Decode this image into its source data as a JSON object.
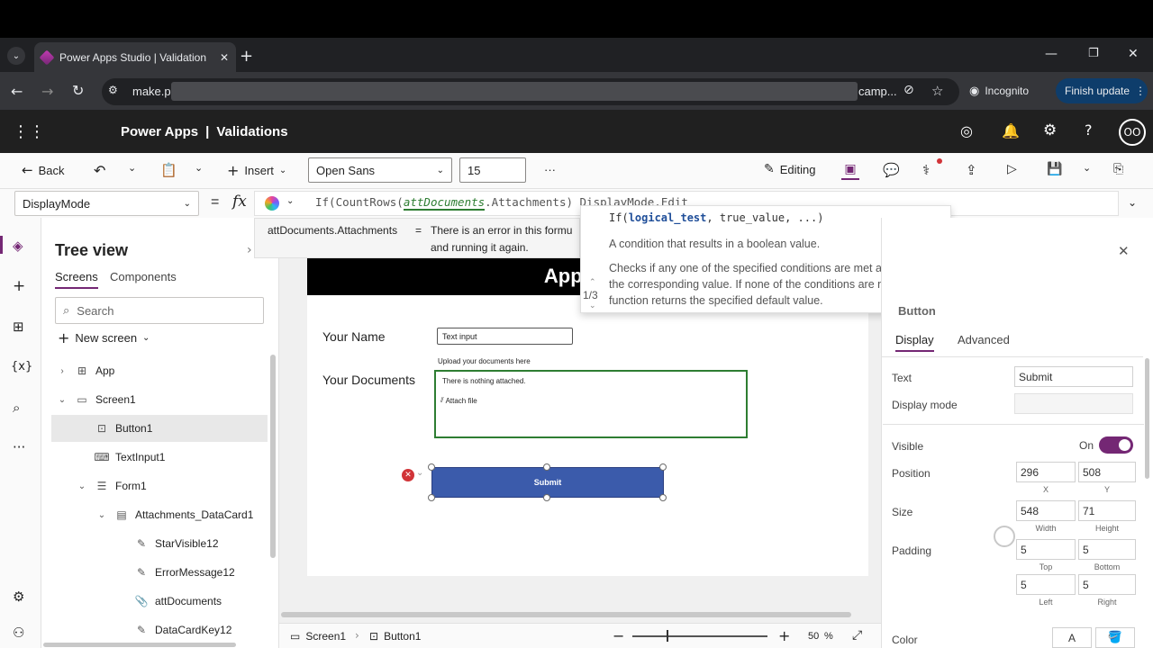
{
  "browser": {
    "tab_title": "Power Apps Studio | Validation",
    "new_tab": "+",
    "url_start": "make.p",
    "url_end": "camp...",
    "incognito": "Incognito",
    "finish_update": "Finish update"
  },
  "app_header": {
    "product": "Power Apps",
    "separator": "|",
    "app_name": "Validations",
    "avatar": "OO"
  },
  "command_bar": {
    "back": "Back",
    "insert": "Insert",
    "font": "Open Sans",
    "font_size": "15",
    "more": "···",
    "editing": "Editing"
  },
  "formula_bar": {
    "property": "DisplayMode",
    "equals": "=",
    "fx": "fx",
    "formula_part1": "If(CountRows(",
    "formula_arg": "attDocuments",
    "formula_part2": ".Attachments)",
    "formula_part3": " DisplayMode.Edit"
  },
  "error_popup": {
    "term": "attDocuments.Attachments",
    "equals": "=",
    "line1": "There is an error in this formu",
    "line2": "and running it again."
  },
  "intellisense": {
    "signature_prefix": "If(",
    "signature_param": "logical_test",
    "signature_rest": ", true_value, ...)",
    "counter": "1/3",
    "desc1": "A condition that results in a boolean value.",
    "desc2": "Checks if any one of the specified conditions are met and returns the corresponding value. If none of the conditions are met, the function returns the specified default value."
  },
  "tree": {
    "title": "Tree view",
    "tabs": [
      "Screens",
      "Components"
    ],
    "search_placeholder": "Search",
    "new_screen": "New screen",
    "items": [
      {
        "label": "App",
        "chev": "›",
        "icon": "⊞"
      },
      {
        "label": "Screen1",
        "chev": "⌄",
        "icon": "▭"
      },
      {
        "label": "Button1",
        "chev": "",
        "icon": "⊡"
      },
      {
        "label": "TextInput1",
        "chev": "",
        "icon": "⌨"
      },
      {
        "label": "Form1",
        "chev": "⌄",
        "icon": "☰"
      },
      {
        "label": "Attachments_DataCard1",
        "chev": "⌄",
        "icon": "▤"
      },
      {
        "label": "StarVisible12",
        "chev": "",
        "icon": "✎"
      },
      {
        "label": "ErrorMessage12",
        "chev": "",
        "icon": "✎"
      },
      {
        "label": "attDocuments",
        "chev": "",
        "icon": "📎"
      },
      {
        "label": "DataCardKey12",
        "chev": "",
        "icon": "✎"
      }
    ]
  },
  "canvas": {
    "header_text": "Applic",
    "name_label": "Your Name",
    "text_input_placeholder": "Text input",
    "upload_hint": "Upload your documents here",
    "docs_label": "Your Documents",
    "nothing_attached": "There is nothing attached.",
    "attach_file": "Attach file",
    "submit": "Submit"
  },
  "status": {
    "screen": "Screen1",
    "control": "Button1",
    "zoom": "50",
    "zoom_unit": "%"
  },
  "properties": {
    "control_name": "Button",
    "tabs": [
      "Display",
      "Advanced"
    ],
    "text_label": "Text",
    "text_value": "Submit",
    "display_mode_label": "Display mode",
    "visible_label": "Visible",
    "visible_state": "On",
    "position_label": "Position",
    "x": "296",
    "y": "508",
    "x_label": "X",
    "y_label": "Y",
    "size_label": "Size",
    "width": "548",
    "height": "71",
    "width_label": "Width",
    "height_label": "Height",
    "padding_label": "Padding",
    "pad_top": "5",
    "pad_bottom": "5",
    "pad_left": "5",
    "pad_right": "5",
    "top_label": "Top",
    "bottom_label": "Bottom",
    "left_label": "Left",
    "right_label": "Right",
    "color_label": "Color",
    "color_a": "A"
  },
  "colors": {
    "brand_purple": "#742774",
    "submit_blue": "#3b5bab",
    "form_green": "#2e7d32",
    "toggle_on": "#742774"
  }
}
